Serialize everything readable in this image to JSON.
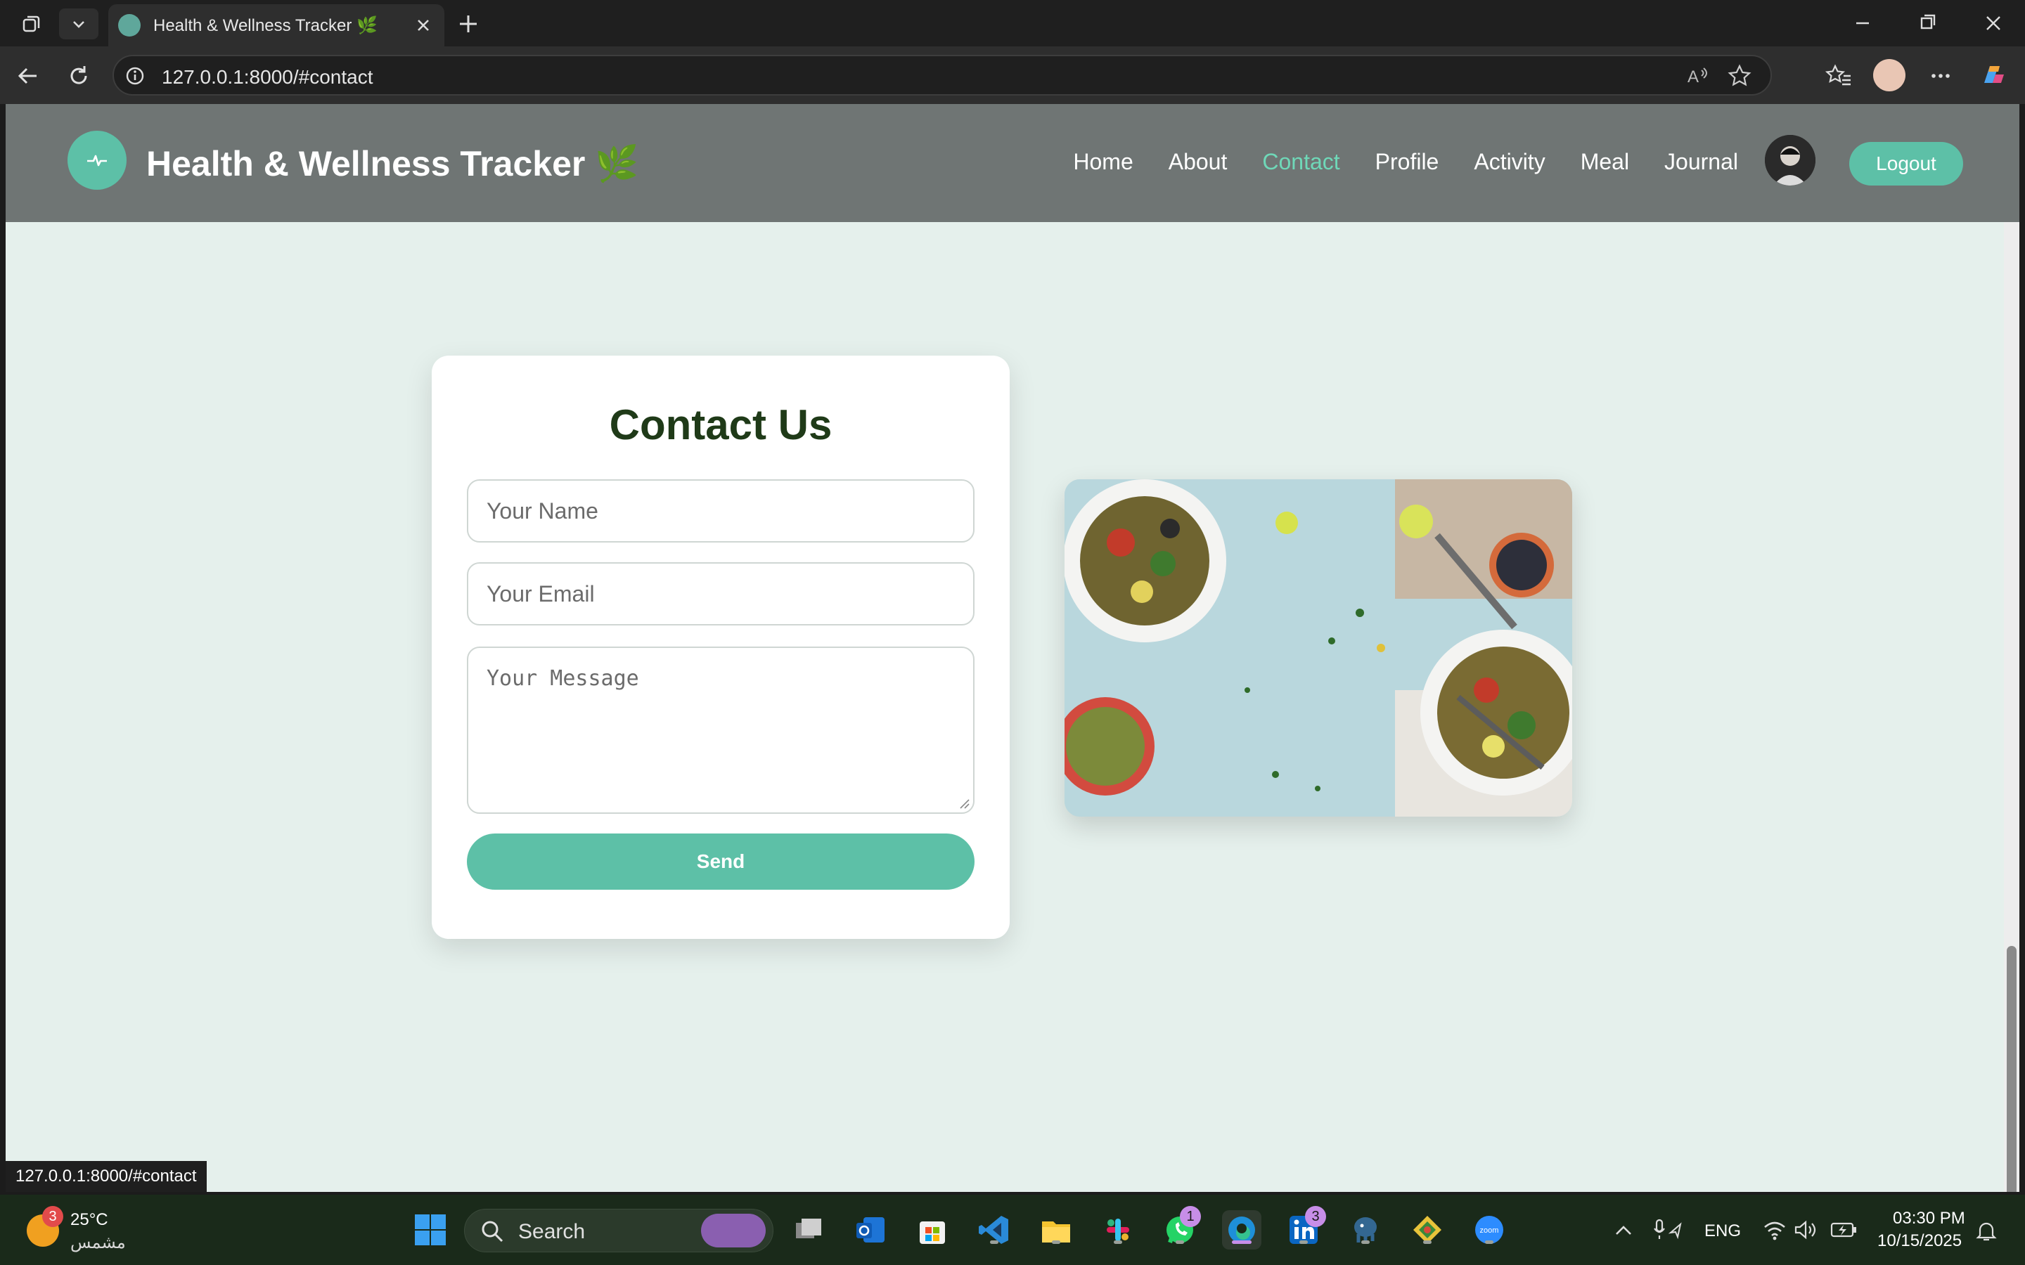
{
  "browser": {
    "tab_title": "Health & Wellness Tracker 🌿",
    "url": "127.0.0.1:8000/#contact",
    "status_url": "127.0.0.1:8000/#contact"
  },
  "site": {
    "brand": "Health & Wellness Tracker 🌿",
    "nav": [
      "Home",
      "About",
      "Contact",
      "Profile",
      "Activity",
      "Meal",
      "Journal"
    ],
    "active_nav": "Contact",
    "logout_label": "Logout",
    "accent_color": "#5dc0a7"
  },
  "contact": {
    "title": "Contact Us",
    "name_placeholder": "Your Name",
    "email_placeholder": "Your Email",
    "message_placeholder": "Your Message",
    "send_label": "Send"
  },
  "taskbar": {
    "weather_temp": "25°C",
    "weather_desc": "مشمس",
    "weather_badge": "3",
    "search_label": "Search",
    "whatsapp_badge": "1",
    "linkedin_badge": "3",
    "lang": "ENG",
    "time": "03:30 PM",
    "date": "10/15/2025"
  }
}
